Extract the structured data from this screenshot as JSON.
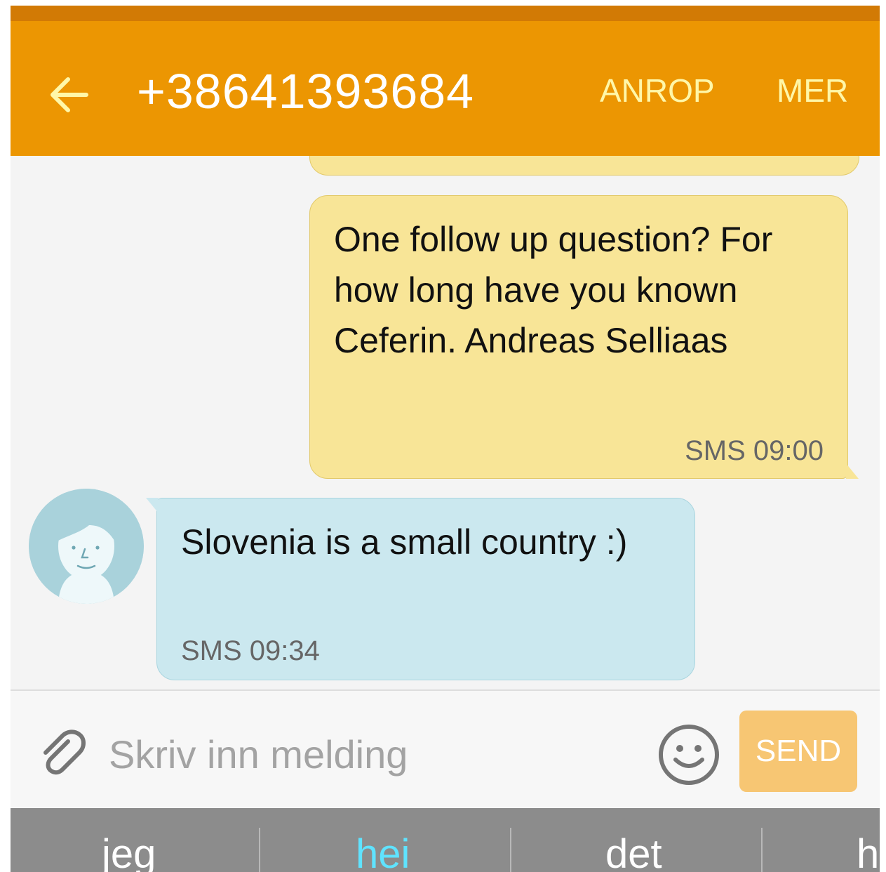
{
  "app_bar": {
    "title": "+38641393684",
    "call_label": "ANROP",
    "more_label": "MER"
  },
  "messages": [
    {
      "direction": "outgoing",
      "text": "One follow up question? For how long have you known Ceferin. Andreas Selliaas",
      "meta": "SMS 09:00"
    },
    {
      "direction": "incoming",
      "text": "Slovenia is a small country :)",
      "meta": "SMS 09:34"
    }
  ],
  "composer": {
    "placeholder": "Skriv inn melding",
    "value": "",
    "send_label": "SEND"
  },
  "keyboard_suggestions": [
    "jeg",
    "hei",
    "det",
    "h"
  ],
  "colors": {
    "app_bar": "#ec9602",
    "status_strip": "#d27a05",
    "outgoing_bubble": "#f8e597",
    "incoming_bubble": "#cbe8ef",
    "send_button": "#f7c673",
    "suggestion_active": "#5fe3ff"
  },
  "icons": {
    "back": "arrow-left-icon",
    "attach": "paperclip-icon",
    "emoji": "smiley-icon",
    "avatar": "contact-avatar-icon"
  }
}
